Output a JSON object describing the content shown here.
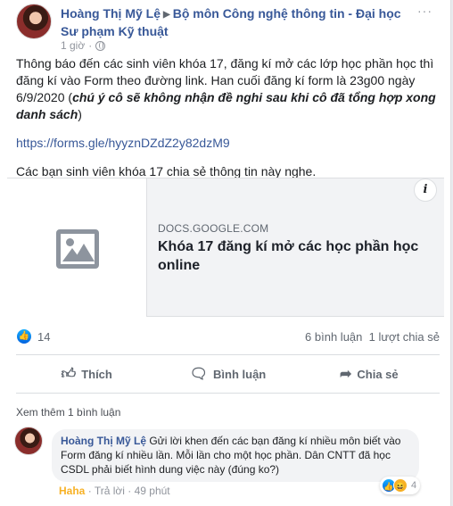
{
  "post": {
    "author": "Hoàng Thị Mỹ Lệ",
    "group": "Bộ môn Công nghệ thông tin - Đại học Sư phạm Kỹ thuật",
    "time": "1 giờ",
    "more": "···",
    "paragraph1_plain": "Thông báo đến các sinh viên khóa 17, đăng kí mở các lớp học phần học thì đăng kí vào Form theo đường link. Han cuối đăng kí form là 23g00 ngày 6/9/2020 (",
    "paragraph1_bold": "chú ý cô sẽ không nhận đề nghi sau khi cô đã tổng hợp xong danh sách",
    "paragraph1_end": ")",
    "link": "https://forms.gle/hyyznDZdZ2y82dzM9",
    "paragraph3": "Các bạn sinh viên khóa 17 chia sẻ thông tin này nghe."
  },
  "preview": {
    "domain": "DOCS.GOOGLE.COM",
    "title": "Khóa 17 đăng kí mở các học phần học online",
    "info": "i"
  },
  "stats": {
    "likes": "14",
    "comments": "6 bình luận",
    "shares": "1 lượt chia sẻ"
  },
  "actions": {
    "like": "Thích",
    "comment": "Bình luận",
    "share": "Chia sẻ"
  },
  "comments": {
    "see_more": "Xem thêm 1 bình luận",
    "items": [
      {
        "author": "Hoàng Thị Mỹ Lệ",
        "text": "Gửi lời khen đến các bạn đăng kí nhiều môn biết vào Form đăng kí nhiều lần. Mỗi lần cho một học phần. Dân CNTT đã học CSDL phải biết hình dung việc này (đúng ko?)",
        "reaction_label": "Haha",
        "reply": "Trả lời",
        "time": "49 phút",
        "reaction_count": "4"
      }
    ]
  },
  "colors": {
    "link": "#385898",
    "like_blue": "#1877f2",
    "haha_yellow": "#f7b125"
  }
}
